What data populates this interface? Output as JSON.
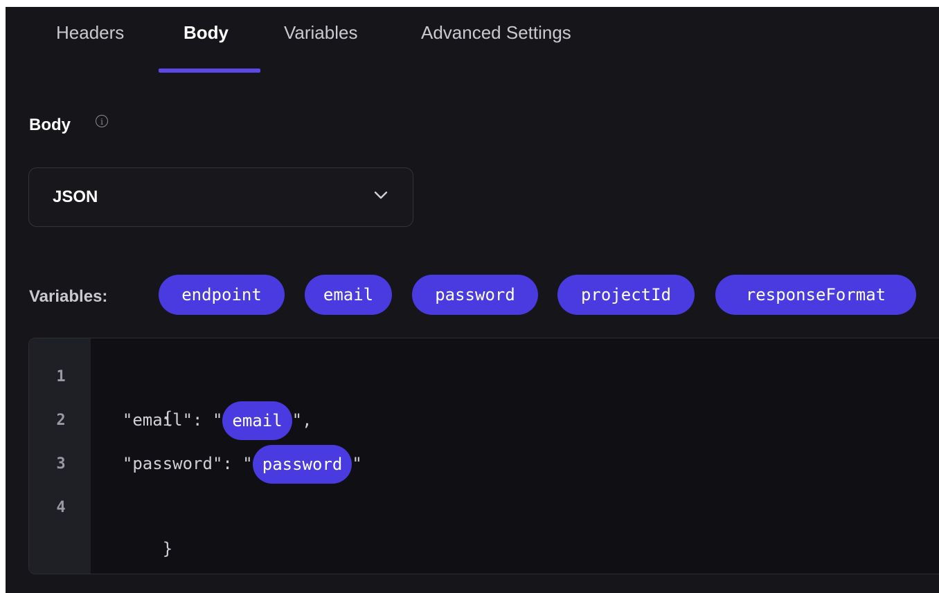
{
  "tabs": [
    {
      "label": "Headers"
    },
    {
      "label": "Body"
    },
    {
      "label": "Variables"
    },
    {
      "label": "Advanced Settings"
    }
  ],
  "active_tab": "Body",
  "section": {
    "title": "Body",
    "info_icon": "info-icon"
  },
  "body_type_select": {
    "value": "JSON",
    "icon": "chevron-down-icon"
  },
  "variables": {
    "label": "Variables:",
    "chips": [
      "endpoint",
      "email",
      "password",
      "projectId",
      "responseFormat"
    ]
  },
  "editor": {
    "line_numbers": [
      "1",
      "2",
      "3",
      "4"
    ],
    "lines": [
      {
        "text": "{"
      },
      {
        "before": "  \"email\": \"",
        "variable": "email",
        "after": "\","
      },
      {
        "before": "  \"password\": \"",
        "variable": "password",
        "after": "\""
      },
      {
        "text": "}"
      }
    ]
  },
  "colors": {
    "accent": "#4a3be0",
    "tab_underline": "#5c48e6",
    "background": "#16161a"
  }
}
